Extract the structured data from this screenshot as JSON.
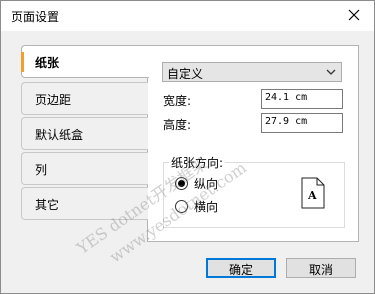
{
  "window": {
    "title": "页面设置"
  },
  "tabs": [
    {
      "label": "纸张",
      "active": true
    },
    {
      "label": "页边距",
      "active": false
    },
    {
      "label": "默认纸盒",
      "active": false
    },
    {
      "label": "列",
      "active": false
    },
    {
      "label": "其它",
      "active": false
    }
  ],
  "paper": {
    "size_select": "自定义",
    "width_label": "宽度:",
    "width_value": "24.1 cm",
    "height_label": "高度:",
    "height_value": "27.9 cm",
    "orientation_group": "纸张方向:",
    "portrait_label": "纵向",
    "landscape_label": "横向",
    "selected_orientation": "portrait",
    "preview_letter": "A"
  },
  "buttons": {
    "ok": "确定",
    "cancel": "取消"
  },
  "watermark": {
    "line1": "YES dotnet开发框架",
    "line2": "www.yesdotnet.com"
  },
  "colors": {
    "accent": "#f0a030",
    "focus": "#0078d7"
  }
}
